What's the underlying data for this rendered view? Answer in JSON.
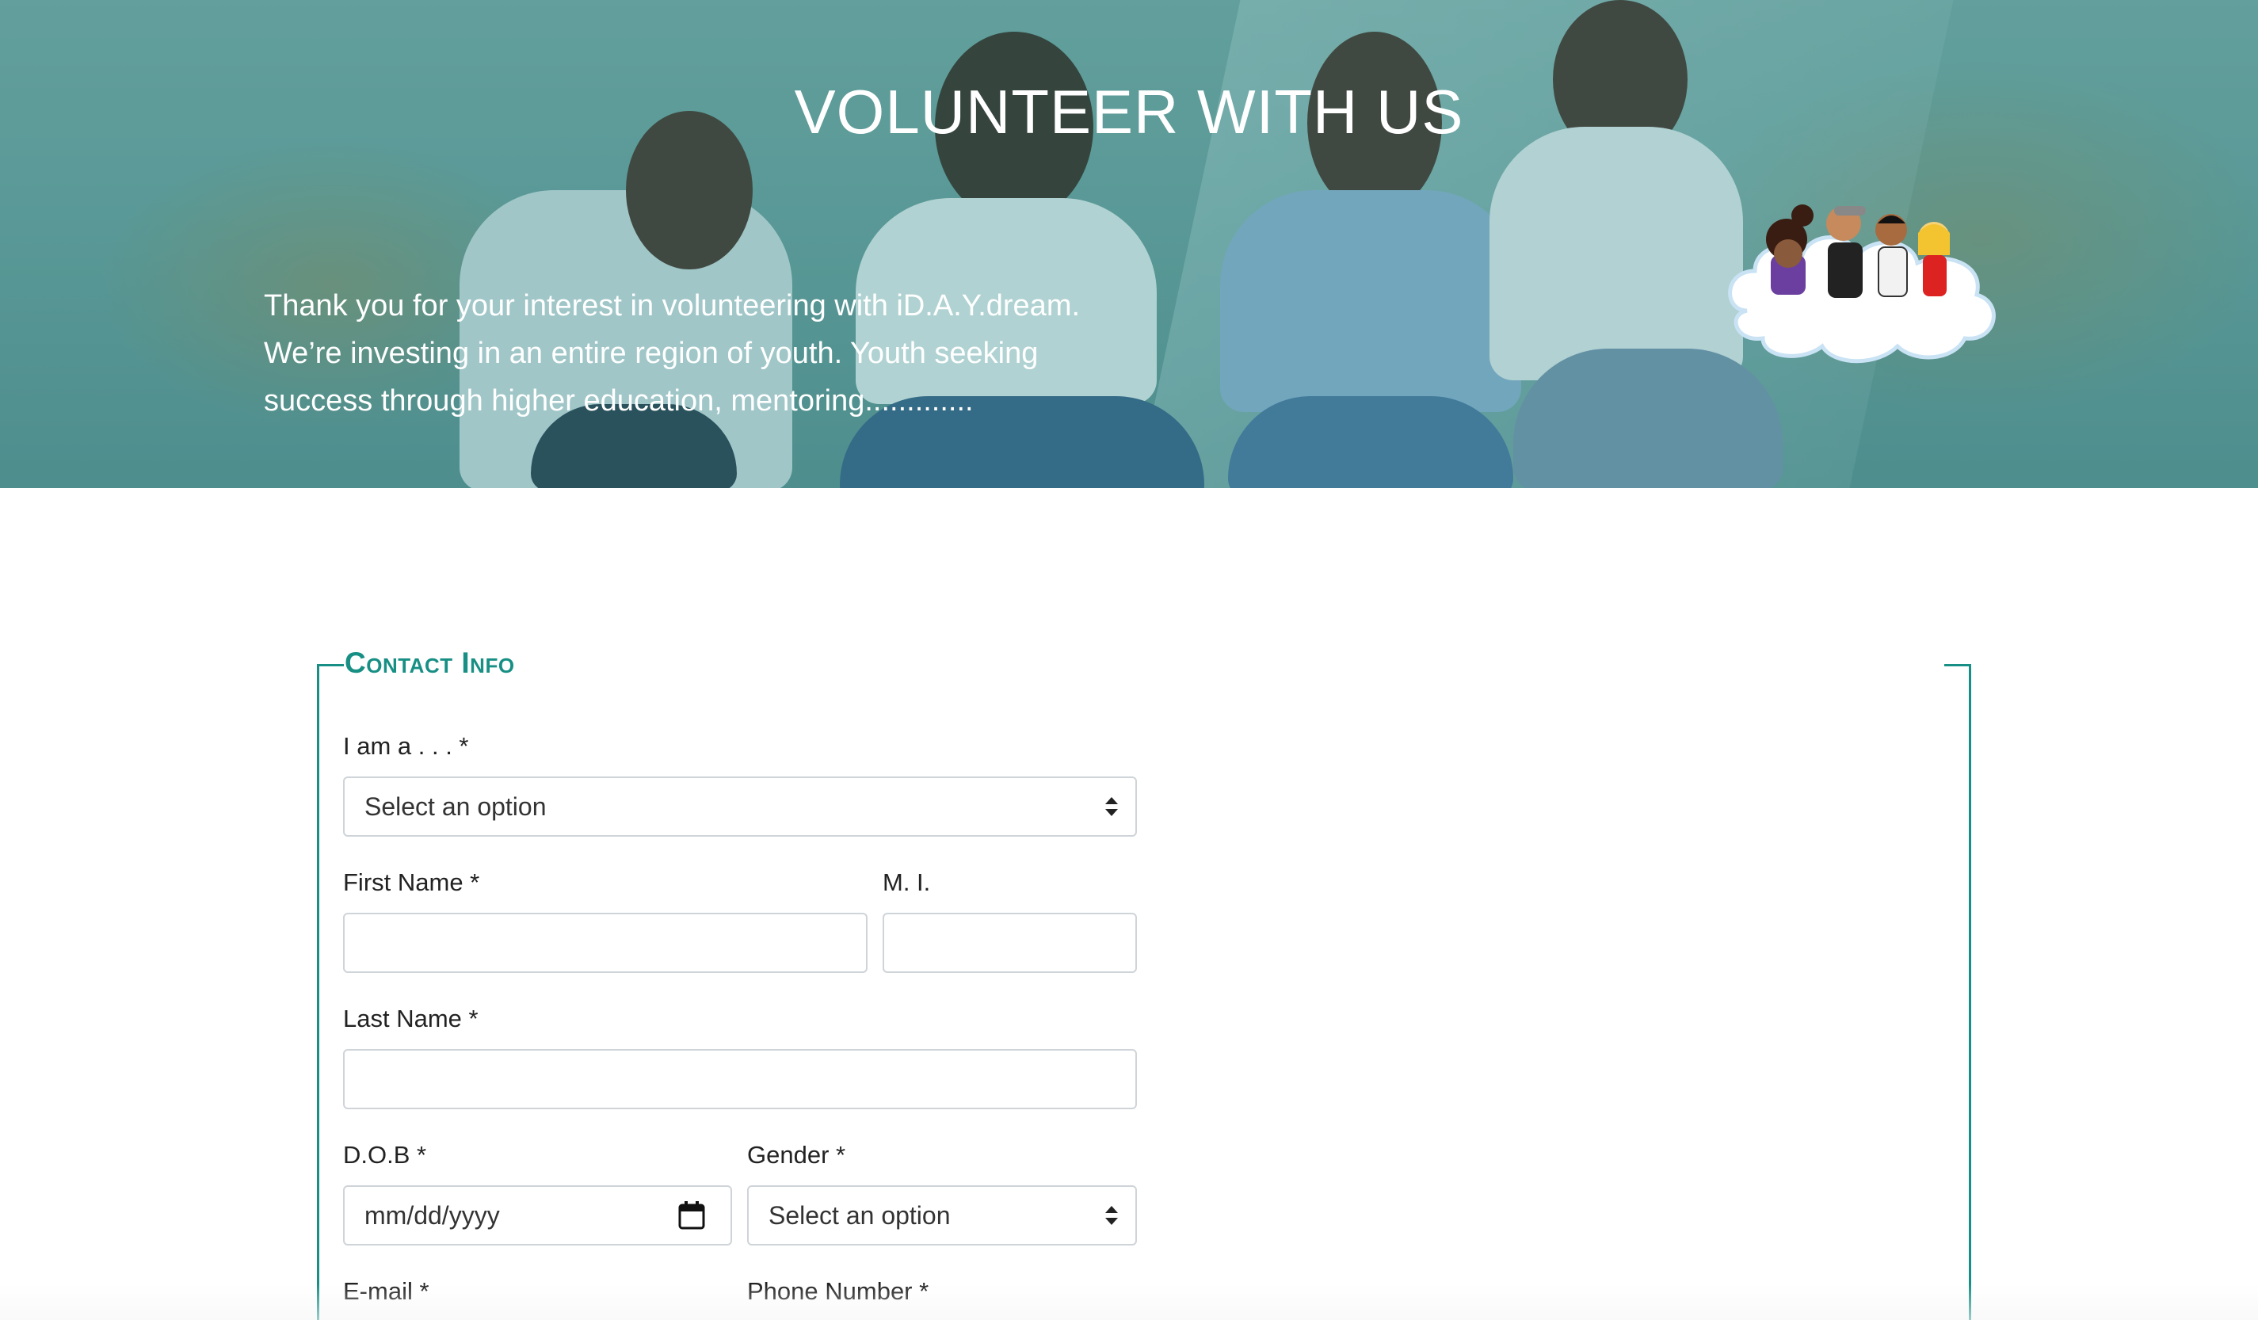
{
  "hero": {
    "title": "VOLUNTEER WITH US",
    "intro_lines": [
      "Thank you for your interest in volunteering with iD.A.Y.dream.",
      "We’re investing in an entire region of youth. Youth seeking",
      "success through higher education, mentoring............."
    ]
  },
  "form": {
    "legend": "Contact Info",
    "i_am_a": {
      "label": "I am a . . . *",
      "value": "Select an option"
    },
    "first_name": {
      "label": "First Name *",
      "value": ""
    },
    "middle_initial": {
      "label": "M. I.",
      "value": ""
    },
    "last_name": {
      "label": "Last Name *",
      "value": ""
    },
    "dob": {
      "label": "D.O.B *",
      "placeholder": "mm/dd/yyyy"
    },
    "gender": {
      "label": "Gender *",
      "value": "Select an option"
    },
    "email": {
      "label": "E-mail *"
    },
    "phone": {
      "label": "Phone Number *"
    }
  },
  "colors": {
    "accent": "#178f84",
    "hero_tint": "#5fa3a0"
  },
  "icons": [
    "calendar-icon",
    "select-arrows-icon",
    "logo-cloud-icon"
  ]
}
